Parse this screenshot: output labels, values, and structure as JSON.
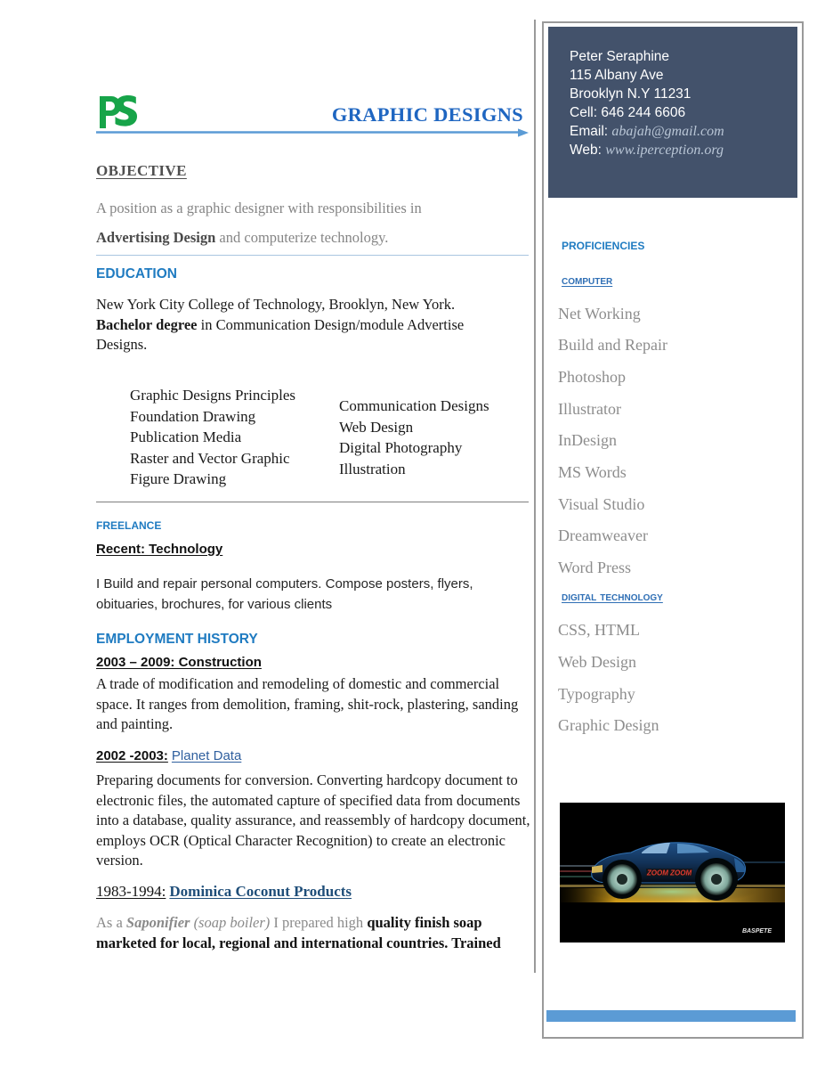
{
  "document": {
    "title": "GRAPHIC DESIGNS",
    "logo_text": "PS",
    "logo_color": "#17a449",
    "accent_blue": "#1f7bc1",
    "title_blue": "#1f66c1",
    "panel_color": "#43526b",
    "bottom_bar_color": "#5b9bd5"
  },
  "contact": {
    "name": "Peter Seraphine",
    "address_line": "115 Albany Ave",
    "city_line": "Brooklyn N.Y 11231",
    "cell_label": "Cell:",
    "cell_value": "646 244 6606",
    "email_label": "Email:",
    "email_value": "abajah@gmail.com",
    "web_label": "Web:",
    "web_value": "www.iperception.org"
  },
  "objective": {
    "heading": "OBJECTIVE",
    "line1": "A position as a graphic designer with responsibilities in",
    "line2_bold": "Advertising Design",
    "line2_rest": " and computerize technology."
  },
  "education": {
    "heading": "EDUCATION",
    "school": "New York City College of Technology, Brooklyn, New York.",
    "degree_bold": "Bachelor degree",
    "degree_rest": " in Communication Design/module Advertise",
    "degree_line3": "Designs.",
    "courses_left": [
      "Graphic Designs Principles",
      "Foundation Drawing",
      "Publication Media",
      "Raster and Vector Graphic",
      "Figure Drawing"
    ],
    "courses_right": [
      "Communication Designs",
      "Web Design",
      "Digital Photography",
      "Illustration"
    ]
  },
  "freelance": {
    "heading": "FREELANCE",
    "subheading": "Recent: Technology",
    "body_line1": "I Build and repair personal computers.  Compose posters, flyers,",
    "body_line2": "obituaries, brochures, for various clients"
  },
  "employment": {
    "heading": "EMPLOYMENT HISTORY",
    "jobs": [
      {
        "period": "2003 – 2009: Construction",
        "period_style": "sans-bold-u",
        "company": "",
        "body": "A trade of modification and remodeling of domestic and commercial space.  It ranges from demolition, framing, shit-rock, plastering, sanding and painting."
      },
      {
        "period": "2002 -2003:",
        "period_style": "sans-bold-u",
        "company": "Planet Data",
        "body": "Preparing documents for conversion.  Converting hardcopy document to electronic files, the automated capture of specified data from documents into a database, quality assurance, and reassembly of hardcopy document, employs OCR (Optical Character Recognition) to create an electronic version."
      },
      {
        "period": "1983-1994:",
        "period_style": "serif-u",
        "company": "Dominica Coconut Products",
        "body_parts": {
          "p1": "As a ",
          "p2": "Saponifier",
          "p3": " (soap boiler)",
          "p4": " I prepared high ",
          "p5": "quality finish soap marketed for local, regional and international countries.  Trained"
        }
      }
    ]
  },
  "proficiencies": {
    "title": "PROFICIENCIES",
    "groups": [
      {
        "label": "COMPUTER",
        "items": [
          "Net Working",
          "Build and Repair",
          "Photoshop",
          "Illustrator",
          "InDesign",
          "MS Words",
          "Visual Studio",
          "Dreamweaver",
          "Word Press"
        ]
      },
      {
        "label": "DIGITAL TECHNOLOGY",
        "items": [
          "CSS, HTML",
          "Web Design",
          "Typography",
          "Graphic Design"
        ]
      }
    ]
  },
  "figure": {
    "name": "sports-car-illustration",
    "door_text": "ZOOM ZOOM",
    "signature": "BASPETE"
  }
}
